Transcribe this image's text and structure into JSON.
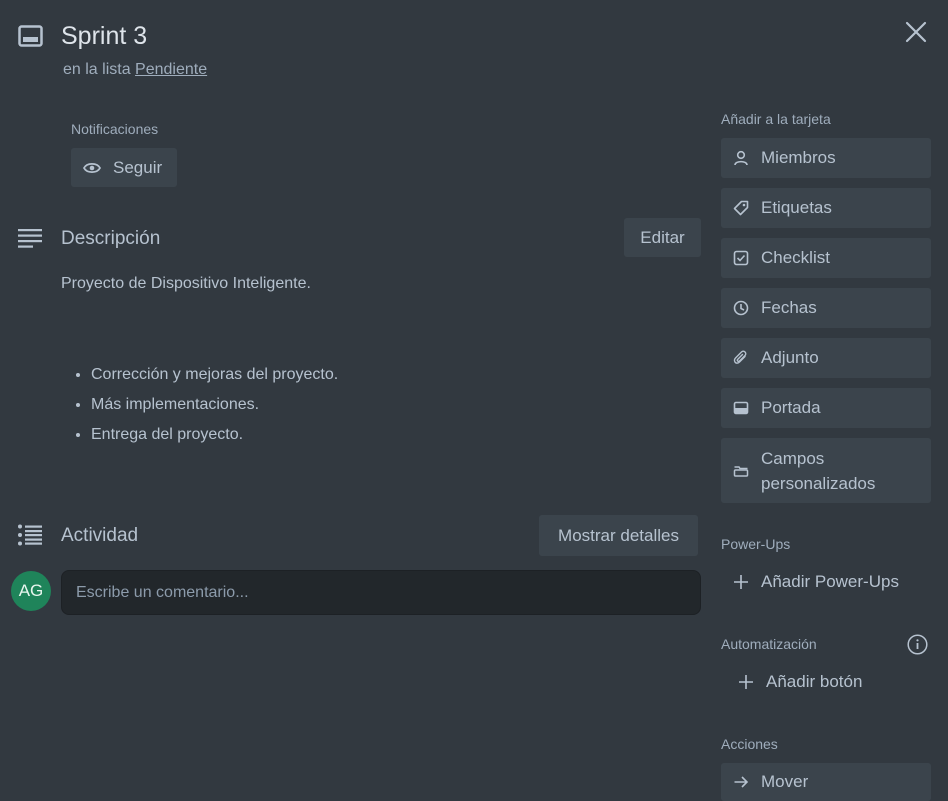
{
  "card": {
    "title": "Sprint 3",
    "list_prefix": "en la lista",
    "list_name": "Pendiente"
  },
  "notifications": {
    "label": "Notificaciones",
    "follow_label": "Seguir"
  },
  "description": {
    "title": "Descripción",
    "edit_label": "Editar",
    "text": "Proyecto de Dispositivo Inteligente.",
    "bullets": [
      "Corrección y mejoras del proyecto.",
      "Más implementaciones.",
      "Entrega del proyecto."
    ]
  },
  "activity": {
    "title": "Actividad",
    "details_label": "Mostrar detalles",
    "avatar_initials": "AG",
    "comment_placeholder": "Escribe un comentario..."
  },
  "sidebar": {
    "add_to_card_label": "Añadir a la tarjeta",
    "buttons": [
      {
        "label": "Miembros",
        "icon": "person-icon"
      },
      {
        "label": "Etiquetas",
        "icon": "tag-icon"
      },
      {
        "label": "Checklist",
        "icon": "checkbox-icon"
      },
      {
        "label": "Fechas",
        "icon": "clock-icon"
      },
      {
        "label": "Adjunto",
        "icon": "paperclip-icon"
      },
      {
        "label": "Portada",
        "icon": "cover-icon"
      },
      {
        "label": "Campos personalizados",
        "icon": "custom-fields-icon"
      }
    ],
    "powerups_label": "Power-Ups",
    "add_powerups_label": "Añadir Power-Ups",
    "automation_label": "Automatización",
    "add_button_label": "Añadir botón",
    "actions_label": "Acciones",
    "move_label": "Mover"
  },
  "colors": {
    "background": "#323940",
    "button": "#3b444c",
    "avatar": "#1f845a"
  }
}
